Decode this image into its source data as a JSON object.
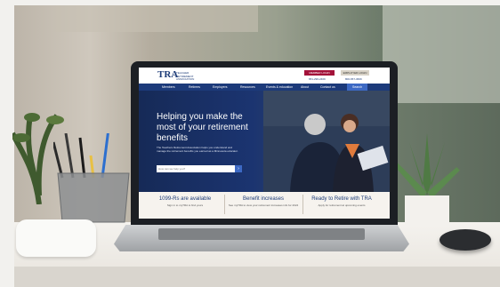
{
  "site": {
    "logo": "TRA",
    "logo_tagline": "TEACHER RETIREMENT ASSOCIATION",
    "buttons": {
      "member_login": "MEMBER LOGIN",
      "employer_login": "EMPLOYER LOGIN"
    },
    "phones": [
      "651-296-2409",
      "800-657-3669"
    ],
    "nav": [
      "Members",
      "Retirees",
      "Employers",
      "Resources",
      "Events & education",
      "About",
      "Contact us",
      "Search"
    ],
    "hero": {
      "title": "Helping you make the most of your retirement benefits",
      "body": "The Teachers Retirement Association helps you understand and manage the retirement benefits you earned as a Minnesota educator.",
      "search_placeholder": "How can we help you?",
      "search_button": "›"
    },
    "cards": [
      {
        "title": "1099-Rs are available",
        "subtitle": "Sign in to myTRA to find yours"
      },
      {
        "title": "Benefit increases",
        "subtitle": "See myTRA to view your retirement increases info for 2024"
      },
      {
        "title": "Ready to Retire with TRA",
        "subtitle": "Apply for retirement at upcoming events"
      }
    ]
  },
  "colors": {
    "brand_navy": "#1c3a7a",
    "brand_red": "#a3123a",
    "search_blue": "#3d69c4"
  }
}
